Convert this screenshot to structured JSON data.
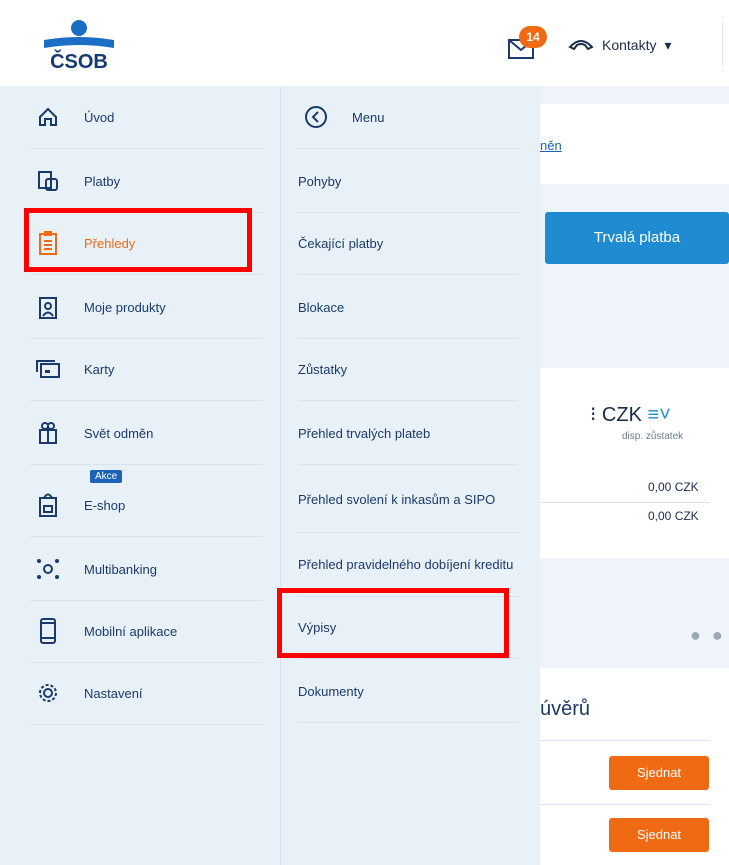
{
  "header": {
    "logo_text": "ČSOB",
    "mail_badge": "14",
    "contacts_label": "Kontakty"
  },
  "menu_left": [
    {
      "label": "Úvod",
      "icon": "home-icon"
    },
    {
      "label": "Platby",
      "icon": "payments-icon"
    },
    {
      "label": "Přehledy",
      "icon": "clipboard-icon",
      "active": true
    },
    {
      "label": "Moje produkty",
      "icon": "products-icon"
    },
    {
      "label": "Karty",
      "icon": "cards-icon"
    },
    {
      "label": "Svět odměn",
      "icon": "gift-icon"
    },
    {
      "label": "E-shop",
      "icon": "shop-icon",
      "badge": "Akce"
    },
    {
      "label": "Multibanking",
      "icon": "multibanking-icon"
    },
    {
      "label": "Mobilní aplikace",
      "icon": "mobile-icon"
    },
    {
      "label": "Nastavení",
      "icon": "gear-icon"
    }
  ],
  "menu_right": {
    "back_label": "Menu",
    "items": [
      "Pohyby",
      "Čekající platby",
      "Blokace",
      "Zůstatky",
      "Přehled trvalých plateb",
      "Přehled svolení k inkasům a SIPO",
      "Přehled pravidelného dobíjení kreditu",
      "Výpisy",
      "Dokumenty"
    ]
  },
  "background": {
    "link_text": "něn",
    "trvala_button": "Trvalá platba",
    "balance": "CZK",
    "balance_sub": "disp. zůstatek",
    "amount_1": "0,00 CZK",
    "amount_2": "0,00 CZK",
    "section_title": "úvěrů",
    "sjednat_1": "Sjednat",
    "sjednat_2": "Sjednat"
  },
  "colors": {
    "accent_orange": "#ef6a13",
    "brand_blue": "#1a3a6b",
    "highlight_red": "#ff0000"
  }
}
